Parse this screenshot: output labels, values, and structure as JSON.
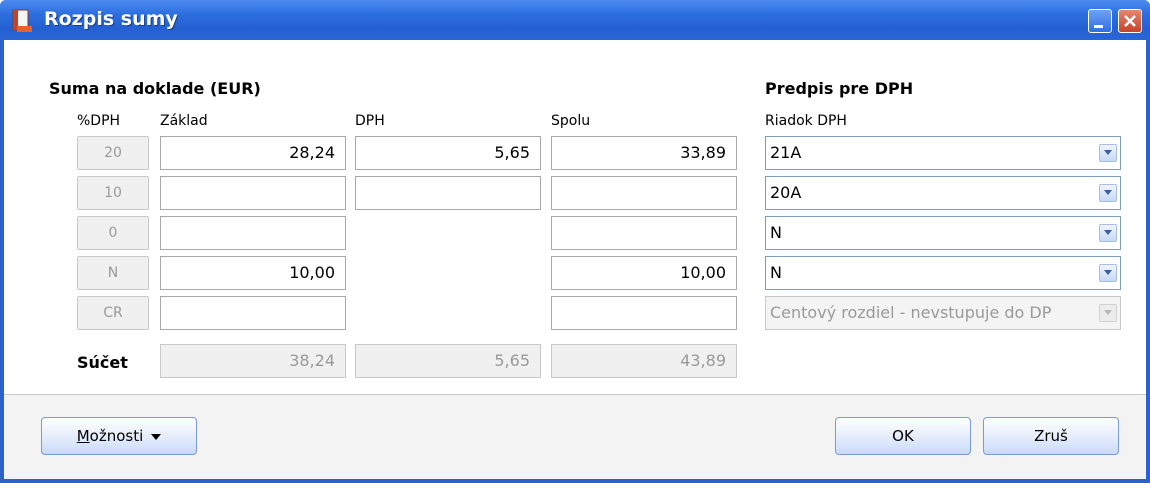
{
  "window": {
    "title": "Rozpis sumy"
  },
  "left_section": {
    "title": "Suma na doklade (EUR)",
    "headers": {
      "pct": "%DPH",
      "zaklad": "Základ",
      "dph": "DPH",
      "spolu": "Spolu"
    },
    "rows": [
      {
        "pct": "20",
        "zaklad": "28,24",
        "dph": "5,65",
        "spolu": "33,89"
      },
      {
        "pct": "10",
        "zaklad": "",
        "dph": "",
        "spolu": ""
      },
      {
        "pct": "0",
        "zaklad": "",
        "spolu": ""
      },
      {
        "pct": "N",
        "zaklad": "10,00",
        "spolu": "10,00"
      },
      {
        "pct": "CR",
        "zaklad": "",
        "spolu": ""
      }
    ],
    "sum": {
      "label": "Súčet",
      "zaklad": "38,24",
      "dph": "5,65",
      "spolu": "43,89"
    }
  },
  "right_section": {
    "title": "Predpis pre DPH",
    "header": "Riadok DPH",
    "combos": [
      {
        "value": "21A"
      },
      {
        "value": "20A"
      },
      {
        "value": "N"
      },
      {
        "value": "N"
      },
      {
        "value": "Centový rozdiel - nevstupuje do DP"
      }
    ]
  },
  "buttons": {
    "options_prefix": "M",
    "options_rest": "ožnosti",
    "ok": "OK",
    "cancel": "Zruš"
  },
  "colors": {
    "titlebar": "#2d6fe0",
    "close": "#c7422a"
  }
}
